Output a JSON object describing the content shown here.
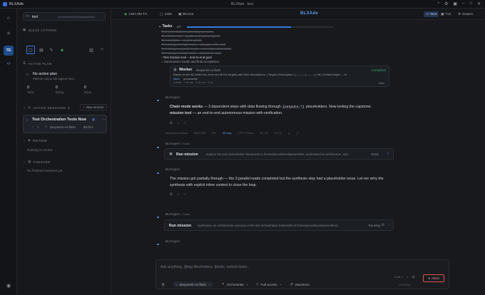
{
  "window": {
    "app_name": "BLXAde",
    "breadcrumb": "BLXAde  ·  test"
  },
  "rail": {
    "active_badge": "TE"
  },
  "sidebar": {
    "project_name": "test",
    "project_path": "/home/ptoux/Development/test",
    "quick_actions_label": "QUICK ACTIONS",
    "active_plan_label": "ACTIVE PLAN",
    "no_plan_title": "No active plan",
    "no_plan_sub": "Planner output will appear here.",
    "counts": [
      {
        "value": "0",
        "label": "Todo"
      },
      {
        "value": "0",
        "label": "Doing"
      },
      {
        "value": "0",
        "label": "Done"
      }
    ],
    "active_sessions_label": "ACTIVE SESSIONS",
    "active_sessions_count": "1",
    "new_session_label": "New session",
    "session": {
      "title": "Test Orchestration Tools Now",
      "msgs": "7",
      "model": "deepseek-v4-flash",
      "cost": "$0.013"
    },
    "review_label": "REVIEW",
    "review_empty": "Nothing to review",
    "finished_label": "FINISHED",
    "finished_empty": "No finished sessions yet"
  },
  "topbar": {
    "tokens": "1467.0M TX",
    "steps": "1156",
    "cost": "$0.013",
    "gui": "GUI",
    "tui": "TUI",
    "swarm": "Swarm",
    "brand": "BLXAde"
  },
  "tasks": {
    "label": "Tasks",
    "count": "5/7",
    "items": [
      "Test orchestration tool tooling scenarios",
      "Test hidden tool – update and track progress",
      "Test todo/plan – read & update",
      "Test subagent single mode – delegate a file read",
      "Test subagent parallel mode – run independent tasks",
      "Test subagent chain mode – dependent steps",
      "Test mission tool – end-to-end goal",
      "Summarize results and final acceptance"
    ]
  },
  "worker": {
    "title": "Worker",
    "model": "deepseek-v4-flash",
    "status": "Completed",
    "summary": "Based on the BLXAde info, here are all the targets with their descriptions. | Target | Description | |----------|---------| | all | Default target — fu",
    "next_label": "Next:",
    "next_value": "orchestrate",
    "meta": "4 tools · 7.4k tok · 1.2k out · 3.1s",
    "view": "View"
  },
  "messages": [
    {
      "author": "BLXAgent",
      "text1_bold": "Chain mode works",
      "text1": " — 3 dependent steps with data flowing through ",
      "code": "{outputs.*}",
      "text1b": " placeholders. Now testing the capstone:",
      "text2_bold": "mission tool",
      "text2": " — an end-to-end autonomous mission with verification.",
      "footer": [
        "deepseek-v4-flash",
        "08:47 PM",
        "6%",
        "33 reqs",
        "TTFT 270ms",
        "33.1 tk",
        "11.3 s"
      ]
    },
    {
      "author": "BLXAgent",
      "tool_tag": "Tools",
      "tool_name": "Ran mission",
      "tool_desc": "Explore the test orchestration framework in /home/ptoux/Development/test, understand its architecture, and...",
      "tool_status": "Done"
    },
    {
      "author": "BLXAgent",
      "text": "The mission got partially through — the 3 parallel reads completed but the synthesis step had a placeholder issue. Let me retry the",
      "text2": "synthesis with explicit inline context to close the loop."
    },
    {
      "author": "BLXAgent",
      "tool_tag": "Tools",
      "tool_name": "Run mission",
      "tool_desc": "Synthesize an architectural overview of the test orchestration framework in /home/ptoux/Development/test...",
      "tool_status": "Running"
    },
    {
      "author": "BLXAgent"
    }
  ],
  "composer": {
    "placeholder": "Ask anything, @tag files/folders, $skills, submit tasks...",
    "model": "deepseek-v4-flash",
    "mode": "Orchestrate",
    "access": "Full access",
    "effort": "Maximum",
    "abort": "Abort",
    "side_hint_1": "0.1M",
    "side_hint_2": "Ctrl+Enter"
  },
  "colors": {
    "accent": "#3a78e0",
    "background": "#17191d",
    "sidebar": "#16181c",
    "abort": "#d9534f",
    "success": "#3fa66b"
  }
}
